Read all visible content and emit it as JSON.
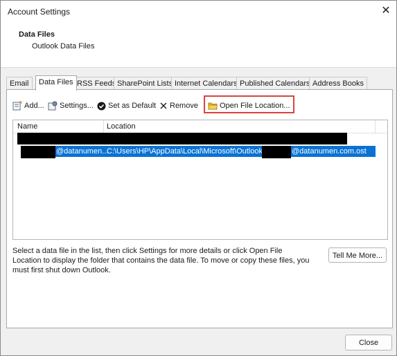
{
  "window": {
    "title": "Account Settings"
  },
  "header": {
    "title": "Data Files",
    "subtitle": "Outlook Data Files"
  },
  "tabs": [
    {
      "label": "Email"
    },
    {
      "label": "Data Files"
    },
    {
      "label": "RSS Feeds"
    },
    {
      "label": "SharePoint Lists"
    },
    {
      "label": "Internet Calendars"
    },
    {
      "label": "Published Calendars"
    },
    {
      "label": "Address Books"
    }
  ],
  "toolbar": {
    "add": "Add...",
    "settings": "Settings...",
    "set_default": "Set as Default",
    "remove": "Remove",
    "open_location": "Open File Location..."
  },
  "list": {
    "col_name": "Name",
    "col_location": "Location",
    "rows": [
      {
        "name": "@datanumen...",
        "location_prefix": "C:\\Users\\HP\\AppData\\Local\\Microsoft\\Outlook\\",
        "location_suffix": "@datanumen.com.ost"
      }
    ]
  },
  "info_text": "Select a data file in the list, then click Settings for more details or click Open File Location to display the folder that contains the data file. To move or copy these files, you must first shut down Outlook.",
  "buttons": {
    "tell_me_more": "Tell Me More...",
    "close": "Close"
  },
  "colors": {
    "selection": "#0a72d4",
    "highlight_box": "#d9443c",
    "folder_icon": "#e8b836"
  }
}
